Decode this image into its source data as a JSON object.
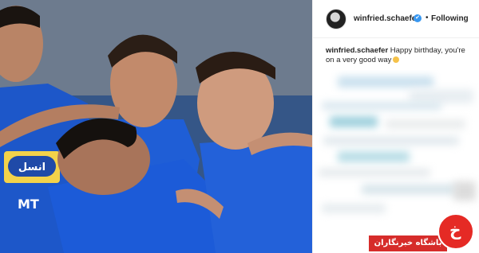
{
  "post": {
    "username": "winfried.schaefer",
    "verified_badge": "✔",
    "separator": "•",
    "follow_status": "Following",
    "caption_user": "winfried.schaefer",
    "caption_text": "Happy birthday, you're on a very good way"
  },
  "photo": {
    "jersey_text_1": "انسل",
    "jersey_text_2": "MT"
  },
  "watermark": {
    "logo_glyph": "خ",
    "label": "باشگاه خبرنگاران"
  },
  "colors": {
    "jersey_blue": "#1f5ed6",
    "verified": "#3897f0",
    "watermark_red": "#e52a25"
  }
}
